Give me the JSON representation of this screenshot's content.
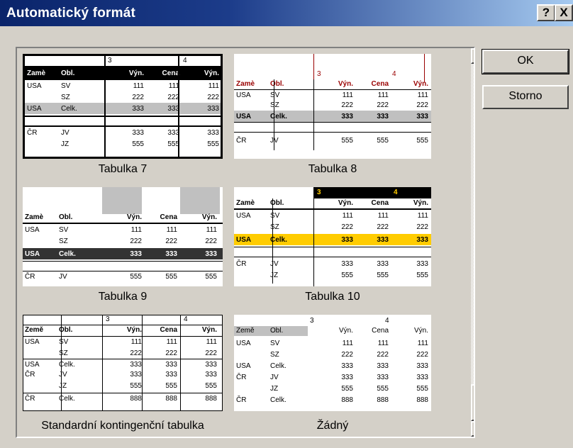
{
  "dialog": {
    "title": "Automatický formát"
  },
  "titlebar": {
    "help_label": "?",
    "close_label": "X"
  },
  "buttons": {
    "ok": "OK",
    "cancel": "Storno"
  },
  "formats": [
    {
      "caption": "Tabulka 7"
    },
    {
      "caption": "Tabulka 8"
    },
    {
      "caption": "Tabulka 9"
    },
    {
      "caption": "Tabulka 10"
    },
    {
      "caption": "Standardní kontingenční tabulka"
    },
    {
      "caption": "Žádný"
    }
  ],
  "table": {
    "header_top": [
      "3",
      "4"
    ],
    "header": [
      "Země",
      "Obl.",
      "Výn.",
      "Cena",
      "Výn."
    ],
    "header_short": [
      "Zamè",
      "Obl.",
      "Výn.",
      "Cena",
      "Výn."
    ],
    "rows": [
      [
        "USA",
        "SV",
        "111",
        "111",
        "111"
      ],
      [
        "",
        "SZ",
        "222",
        "222",
        "222"
      ],
      [
        "USA",
        "Celk.",
        "333",
        "333",
        "333"
      ],
      [
        "ČR",
        "JV",
        "333",
        "333",
        "333"
      ],
      [
        "",
        "JZ",
        "555",
        "555",
        "555"
      ],
      [
        "ČR",
        "Celk.",
        "888",
        "888",
        "888"
      ]
    ],
    "rows_t8": [
      [
        "USA",
        "SV",
        "111",
        "111",
        "111"
      ],
      [
        "",
        "SZ",
        "222",
        "222",
        "222"
      ],
      [
        "USA",
        "Celk.",
        "333",
        "333",
        "333"
      ],
      [
        "ČR",
        "JV",
        "555",
        "555",
        "555"
      ]
    ]
  },
  "colors": {
    "highlight_orange": "#ffcc00",
    "dark_row": "#333333",
    "header_red": "#990000"
  }
}
